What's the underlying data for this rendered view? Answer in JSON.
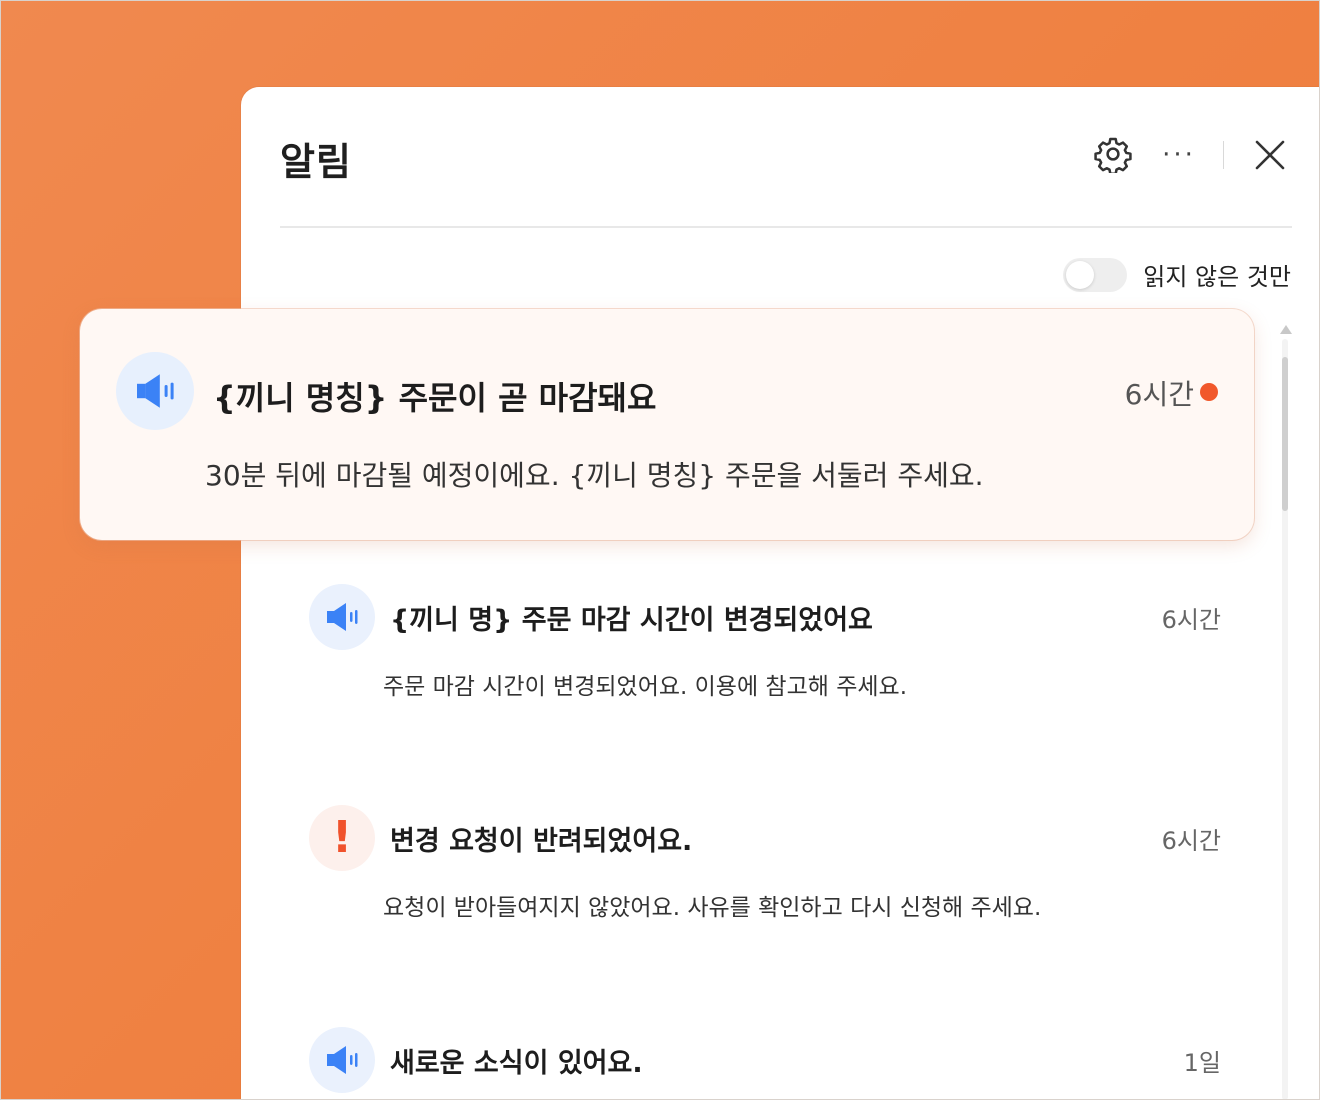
{
  "panel": {
    "title": "알림",
    "unread_only_label": "읽지 않은 것만",
    "unread_only_enabled": false
  },
  "header_icons": [
    "gear-icon",
    "more-icon",
    "close-icon"
  ],
  "notifications": [
    {
      "icon": "megaphone-icon",
      "title": "{끼니 명칭} 주문이 곧 마감돼요",
      "time": "6시간",
      "body": "30분 뒤에 마감될 예정이에요. {끼니 명칭} 주문을 서둘러 주세요.",
      "unread": true
    },
    {
      "icon": "megaphone-icon",
      "title": "{끼니 명} 주문 마감 시간이 변경되었어요",
      "time": "6시간",
      "body": "주문 마감 시간이 변경되었어요. 이용에 참고해 주세요."
    },
    {
      "icon": "exclamation-icon",
      "title": "변경 요청이 반려되었어요.",
      "time": "6시간",
      "body": "요청이 받아들여지지 않았어요. 사유를 확인하고 다시 신청해 주세요."
    },
    {
      "icon": "megaphone-icon",
      "title": "새로운 소식이 있어요.",
      "time": "1일"
    }
  ],
  "colors": {
    "accent": "#f1582b",
    "background": "#ef8142",
    "icon_blue": "#3b82f6"
  }
}
